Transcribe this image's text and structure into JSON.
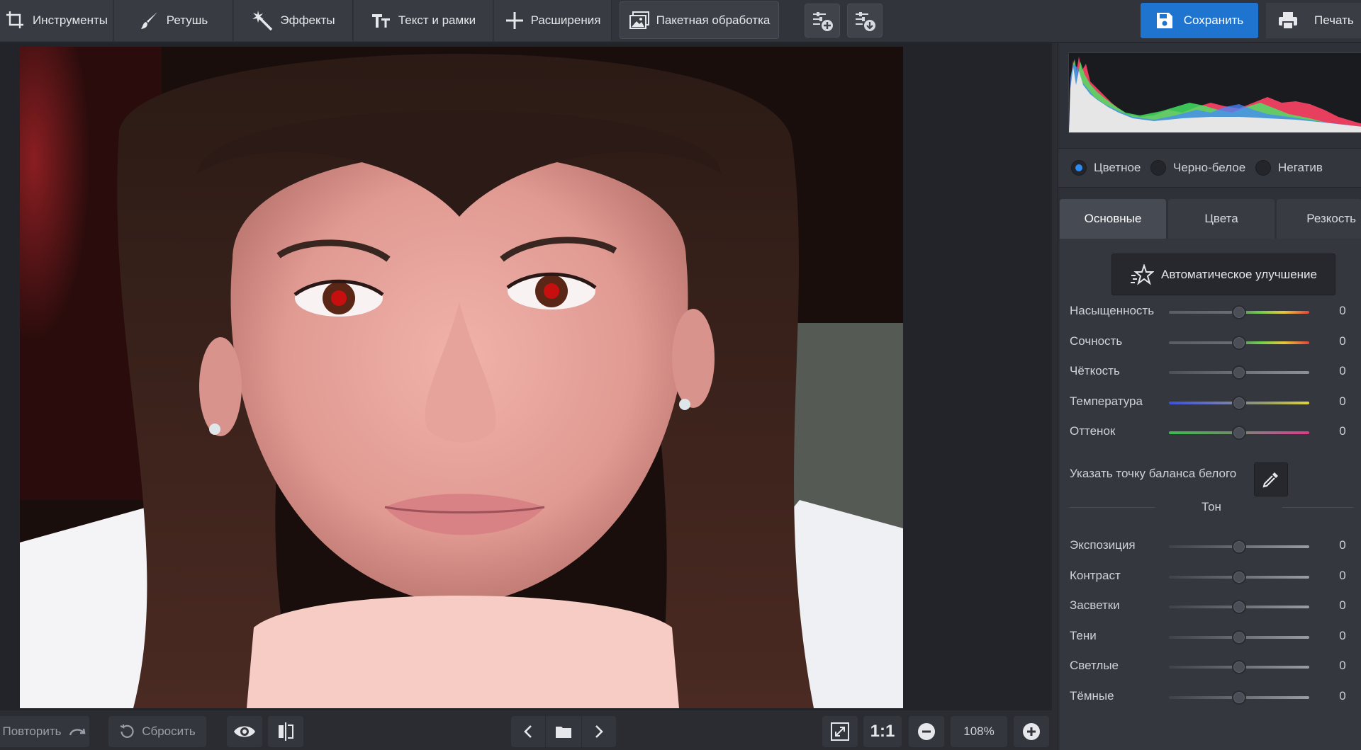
{
  "toolbar": {
    "tools": "Инструменты",
    "retouch": "Ретушь",
    "effects": "Эффекты",
    "text_frames": "Текст и рамки",
    "extensions": "Расширения",
    "batch": "Пакетная обработка",
    "save": "Сохранить",
    "print": "Печать"
  },
  "panel": {
    "modes": [
      {
        "label": "Цветное",
        "selected": true
      },
      {
        "label": "Черно-белое",
        "selected": false
      },
      {
        "label": "Негатив",
        "selected": false
      }
    ],
    "tabs": [
      {
        "label": "Основные",
        "active": true
      },
      {
        "label": "Цвета",
        "active": false
      },
      {
        "label": "Резкость",
        "active": false
      }
    ],
    "auto_enhance": "Автоматическое улучшение",
    "color_sliders": [
      {
        "label": "Насыщенность",
        "value": "0",
        "level": 0.5,
        "gradient": "sat"
      },
      {
        "label": "Сочность",
        "value": "0",
        "level": 0.5,
        "gradient": "sat"
      },
      {
        "label": "Чёткость",
        "value": "0",
        "level": 0.5,
        "gradient": "gray"
      },
      {
        "label": "Температура",
        "value": "0",
        "level": 0.5,
        "gradient": "temp"
      },
      {
        "label": "Оттенок",
        "value": "0",
        "level": 0.5,
        "gradient": "tint"
      }
    ],
    "white_balance_label": "Указать точку баланса белого",
    "tone_section": "Тон",
    "tone_sliders": [
      {
        "label": "Экспозиция",
        "value": "0",
        "level": 0.5
      },
      {
        "label": "Контраст",
        "value": "0",
        "level": 0.5
      },
      {
        "label": "Засветки",
        "value": "0",
        "level": 0.5
      },
      {
        "label": "Тени",
        "value": "0",
        "level": 0.5
      },
      {
        "label": "Светлые",
        "value": "0",
        "level": 0.5
      },
      {
        "label": "Тёмные",
        "value": "0",
        "level": 0.5
      }
    ]
  },
  "bottombar": {
    "redo": "Повторить",
    "reset": "Сбросить",
    "one_to_one": "1:1",
    "zoom": "108%"
  },
  "colors": {
    "accent": "#1f74d0",
    "radio_selected": "#2a8bf2"
  }
}
